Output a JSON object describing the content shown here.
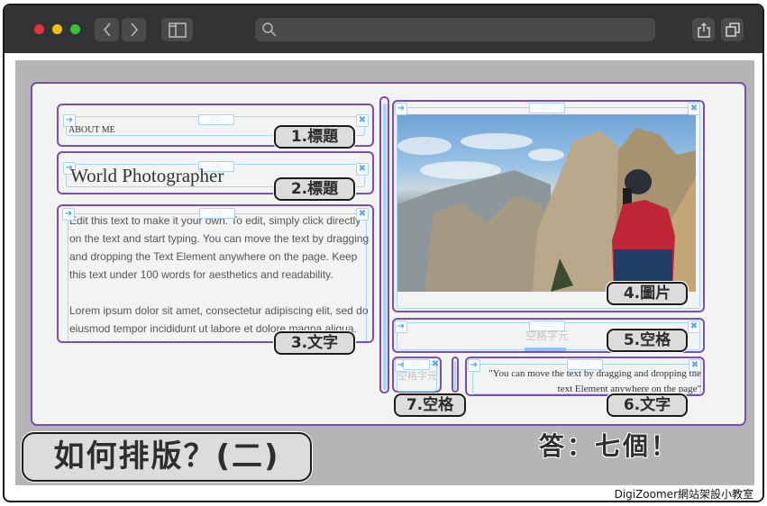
{
  "browser": {
    "traffic_lights": {
      "close": "#e0343f",
      "minimize": "#f2bd1a",
      "zoom": "#36c13b"
    },
    "icons": {
      "back": "chevron-left-icon",
      "forward": "chevron-right-icon",
      "sidebar": "sidebar-icon",
      "search": "search-icon",
      "share": "share-icon",
      "tabs": "tabs-icon"
    },
    "address_value": ""
  },
  "editor": {
    "accent_color": "#7a4fb5",
    "handle_color": "#a9d4f2",
    "handle_icons": {
      "move": "arrow-icon",
      "delete": "close-icon",
      "drag": "drag-grip-icon"
    },
    "drag_glyph": "::::",
    "left_column": {
      "heading1": {
        "text": "ABOUT ME",
        "label": "1.標題"
      },
      "heading2": {
        "text": "World Photographer",
        "label": "2.標題"
      },
      "text3": {
        "paragraphs": [
          "Edit this text to make it your own. To edit, simply click directly on the text and start typing. You can move the text by dragging and dropping the Text Element anywhere on the page. Keep this text under 100 words for aesthetics and readability.",
          "Lorem ipsum dolor sit amet, consectetur adipiscing elit, sed do eiusmod tempor incididunt ut labore et dolore magna aliqua."
        ],
        "label": "3.文字"
      }
    },
    "right_column": {
      "image4": {
        "alt": "Photographer in red jacket photographing mountain cliffs",
        "label": "4.圖片"
      },
      "spacer5": {
        "placeholder": "空格字元",
        "label": "5.空格"
      },
      "spacer7": {
        "placeholder": "空格字元",
        "label": "7.空格"
      },
      "text6": {
        "text": "\"You can move the text by dragging and dropping the text Element anywhere on the page\"",
        "label": "6.文字"
      }
    }
  },
  "overlay": {
    "title": "如何排版？(二)",
    "answer": "答：七個！",
    "credit": "DigiZoomer網站架設小教室"
  }
}
